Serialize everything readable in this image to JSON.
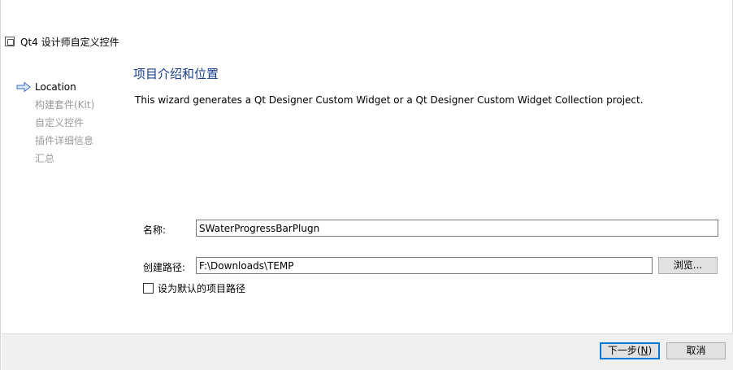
{
  "window": {
    "title": "Qt4 设计师自定义控件",
    "icon": "app-window-icon"
  },
  "sidebar": {
    "steps": [
      {
        "label": "Location",
        "active": true
      },
      {
        "label": "构建套件(Kit)",
        "active": false
      },
      {
        "label": "自定义控件",
        "active": false
      },
      {
        "label": "插件详细信息",
        "active": false
      },
      {
        "label": "汇总",
        "active": false
      }
    ],
    "active_icon": "right-arrow-icon"
  },
  "page": {
    "heading": "项目介绍和位置",
    "description": "This wizard generates a Qt Designer Custom Widget or a Qt Designer Custom Widget Collection project."
  },
  "form": {
    "name_label": "名称:",
    "name_value": "SWaterProgressBarPlugn",
    "path_label": "创建路径:",
    "path_value": "F:\\Downloads\\TEMP",
    "browse_label": "浏览...",
    "default_path_label": "设为默认的项目路径",
    "default_path_checked": false
  },
  "footer": {
    "next_label_pre": "下一步(",
    "next_label_key": "N",
    "next_label_post": ")",
    "cancel_label": "取消"
  },
  "colors": {
    "heading": "#1a3e8f",
    "accent": "#0078d7",
    "inactive_step": "#9a9a9a"
  }
}
